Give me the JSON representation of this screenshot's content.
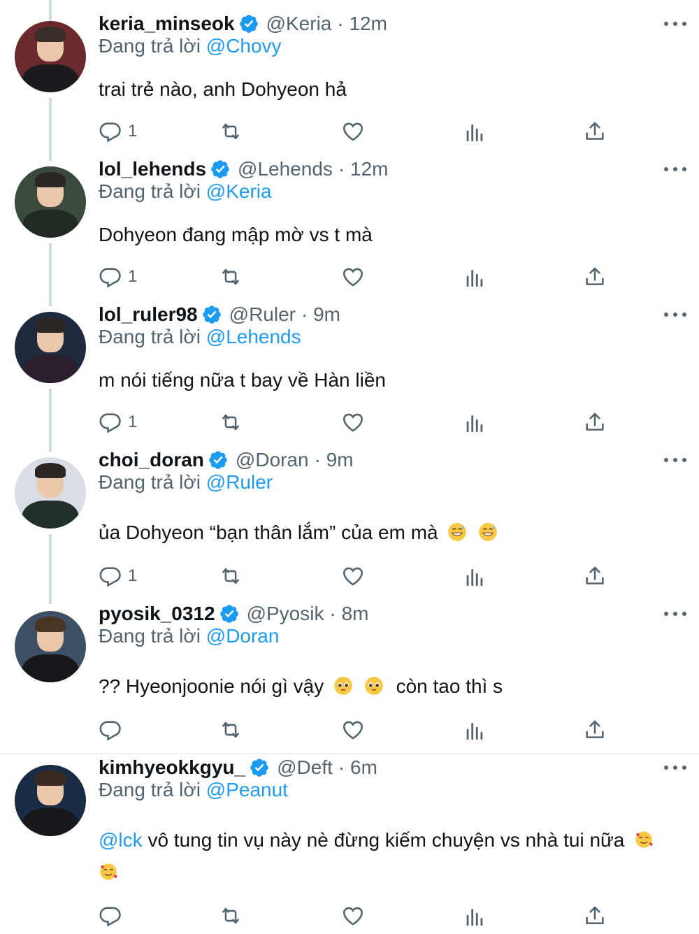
{
  "reply_prefix": "Đang trả lời",
  "tweets": [
    {
      "display_name": "keria_minseok",
      "handle": "@Keria",
      "time": "· 12m",
      "reply_to": "@Chovy",
      "text": "trai trẻ nào, anh Dohyeon hả",
      "reply_count": "1",
      "avatar_bg": "#6b2a2e"
    },
    {
      "display_name": "lol_lehends",
      "handle": "@Lehends",
      "time": "· 12m",
      "reply_to": "@Keria",
      "text": "Dohyeon đang mập mờ vs t mà",
      "reply_count": "1",
      "avatar_bg": "#3a4a3c"
    },
    {
      "display_name": "lol_ruler98",
      "handle": "@Ruler",
      "time": "· 9m",
      "reply_to": "@Lehends",
      "text": "m nói tiếng nữa t bay về Hàn liền",
      "reply_count": "1",
      "avatar_bg": "#1f2a3f"
    },
    {
      "display_name": "choi_doran",
      "handle": "@Doran",
      "time": "· 9m",
      "reply_to": "@Ruler",
      "text": "ủa Dohyeon “bạn thân lắm” của em mà",
      "reply_count": "1",
      "avatar_bg": "#d9dde6"
    },
    {
      "display_name": "pyosik_0312",
      "handle": "@Pyosik",
      "time": "· 8m",
      "reply_to": "@Doran",
      "text_before": "?? Hyeonjoonie nói gì vậy",
      "text_after": "còn tao thì s",
      "reply_count": "",
      "avatar_bg": "#3d5066"
    },
    {
      "display_name": "kimhyeokkgyu_",
      "handle": "@Deft",
      "time": "· 6m",
      "reply_to": "@Peanut",
      "mention": "@lck",
      "text": "vô tung tin vụ này nè đừng kiếm chuyện vs nhà tui nữa",
      "reply_count": "",
      "avatar_bg": "#1a2b44"
    }
  ],
  "icons": {
    "verified": "verified-badge-icon",
    "more": "more-options-icon",
    "reply": "reply-icon",
    "retweet": "retweet-icon",
    "like": "like-icon",
    "views": "analytics-icon",
    "share": "share-icon"
  },
  "colors": {
    "accent": "#1d9bf0",
    "muted": "#536471",
    "text": "#0f1419",
    "thread_line": "#cfd9de"
  }
}
